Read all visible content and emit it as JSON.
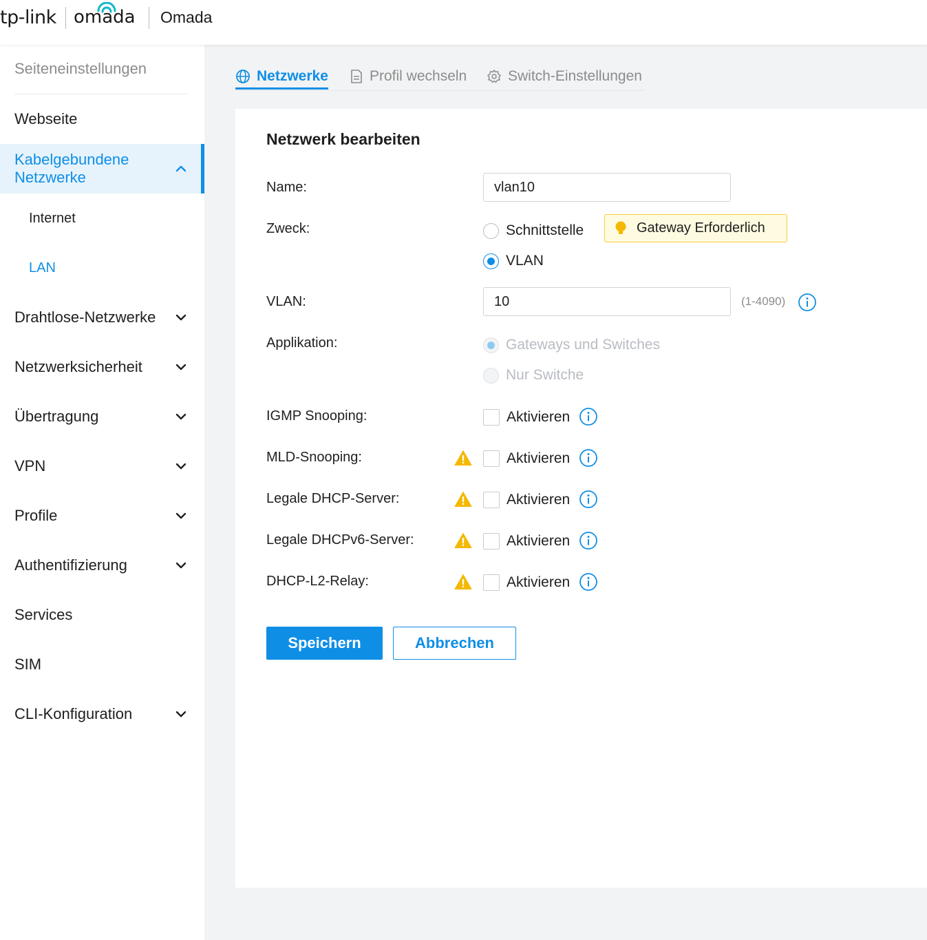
{
  "header": {
    "brand_tplink": "tp-link",
    "brand_omada": "omada",
    "app_title": "Omada"
  },
  "sidebar": {
    "heading": "Seiteneinstellungen",
    "items": [
      {
        "label": "Webseite"
      },
      {
        "label": "Kabelgebundene Netzwerke",
        "expanded": true,
        "active": true,
        "children": [
          {
            "label": "Internet"
          },
          {
            "label": "LAN",
            "selected": true
          }
        ]
      },
      {
        "label": "Drahtlose-Netzwerke"
      },
      {
        "label": "Netzwerksicherheit"
      },
      {
        "label": "Übertragung"
      },
      {
        "label": "VPN"
      },
      {
        "label": "Profile"
      },
      {
        "label": "Authentifizierung"
      },
      {
        "label": "Services"
      },
      {
        "label": "SIM"
      },
      {
        "label": "CLI-Konfiguration"
      }
    ]
  },
  "tabs": [
    {
      "label": "Netzwerke",
      "icon": "globe-icon",
      "active": true
    },
    {
      "label": "Profil wechseln",
      "icon": "document-icon"
    },
    {
      "label": "Switch-Einstellungen",
      "icon": "gear-icon"
    }
  ],
  "form": {
    "title": "Netzwerk bearbeiten",
    "name_label": "Name:",
    "name_value": "vlan10",
    "purpose_label": "Zweck:",
    "purpose_options": [
      "Schnittstelle",
      "VLAN"
    ],
    "purpose_selected": "VLAN",
    "gateway_hint": "Gateway Erforderlich",
    "vlan_label": "VLAN:",
    "vlan_value": "10",
    "vlan_range": "(1-4090)",
    "application_label": "Applikation:",
    "application_options": [
      "Gateways und Switches",
      "Nur Switche"
    ],
    "application_selected": "Gateways und Switches",
    "application_disabled": true,
    "toggles": [
      {
        "label": "IGMP Snooping:",
        "option": "Aktivieren",
        "checked": false,
        "warning": false
      },
      {
        "label": "MLD-Snooping:",
        "option": "Aktivieren",
        "checked": false,
        "warning": true
      },
      {
        "label": "Legale DHCP-Server:",
        "option": "Aktivieren",
        "checked": false,
        "warning": true
      },
      {
        "label": "Legale DHCPv6-Server:",
        "option": "Aktivieren",
        "checked": false,
        "warning": true
      },
      {
        "label": "DHCP-L2-Relay:",
        "option": "Aktivieren",
        "checked": false,
        "warning": true
      }
    ],
    "save_label": "Speichern",
    "cancel_label": "Abbrechen"
  },
  "colors": {
    "accent": "#0f8ee6",
    "warning": "#f5b800",
    "hint_bg": "#fffbe0"
  }
}
